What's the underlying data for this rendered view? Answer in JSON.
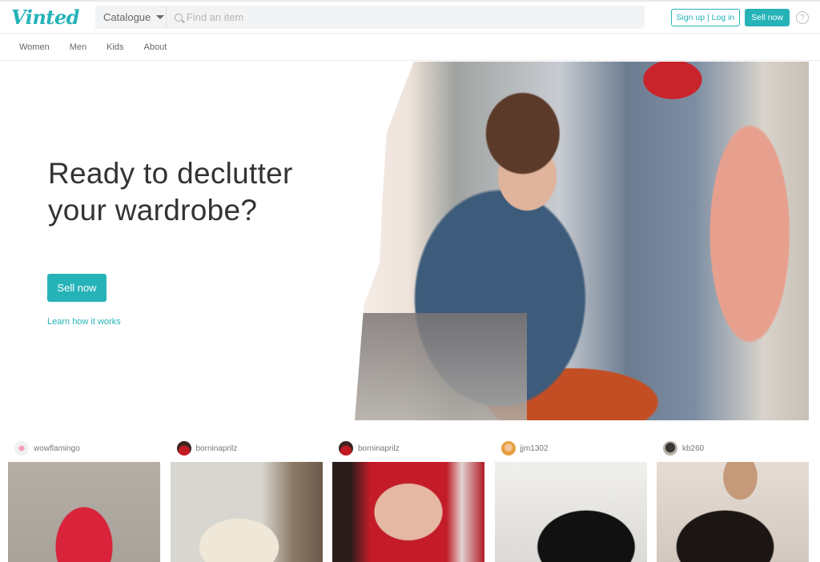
{
  "header": {
    "logo": "Vinted",
    "catalogue_label": "Catalogue",
    "search_placeholder": "Find an item",
    "signup_login_label": "Sign up | Log in",
    "sell_now_label": "Sell now",
    "help_label": "?"
  },
  "nav": {
    "items": [
      {
        "label": "Women"
      },
      {
        "label": "Men"
      },
      {
        "label": "Kids"
      },
      {
        "label": "About"
      }
    ]
  },
  "hero": {
    "title_line1": "Ready to declutter",
    "title_line2": "your wardrobe?",
    "sell_button_label": "Sell now",
    "learn_link_label": "Learn how it works"
  },
  "feed": {
    "items": [
      {
        "username": "wowflamingo"
      },
      {
        "username": "borninaprilz"
      },
      {
        "username": "borninaprilz"
      },
      {
        "username": "jjm1302"
      },
      {
        "username": "kb260"
      }
    ]
  },
  "colors": {
    "brand": "#26b3b8",
    "text": "#333333"
  }
}
